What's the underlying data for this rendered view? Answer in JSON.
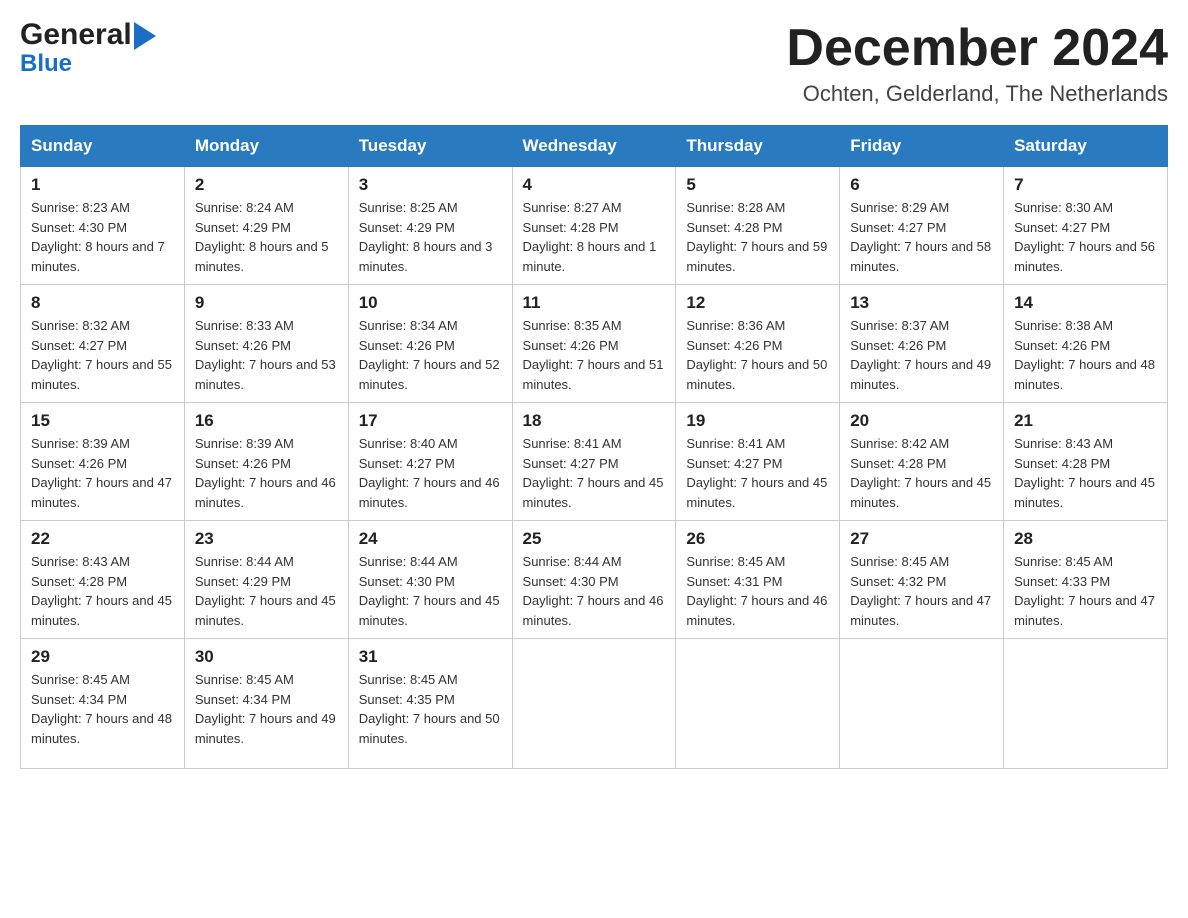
{
  "header": {
    "logo_general": "General",
    "logo_blue": "Blue",
    "month_year": "December 2024",
    "location": "Ochten, Gelderland, The Netherlands"
  },
  "days_of_week": [
    "Sunday",
    "Monday",
    "Tuesday",
    "Wednesday",
    "Thursday",
    "Friday",
    "Saturday"
  ],
  "weeks": [
    [
      {
        "day": "1",
        "sunrise": "8:23 AM",
        "sunset": "4:30 PM",
        "daylight": "8 hours and 7 minutes."
      },
      {
        "day": "2",
        "sunrise": "8:24 AM",
        "sunset": "4:29 PM",
        "daylight": "8 hours and 5 minutes."
      },
      {
        "day": "3",
        "sunrise": "8:25 AM",
        "sunset": "4:29 PM",
        "daylight": "8 hours and 3 minutes."
      },
      {
        "day": "4",
        "sunrise": "8:27 AM",
        "sunset": "4:28 PM",
        "daylight": "8 hours and 1 minute."
      },
      {
        "day": "5",
        "sunrise": "8:28 AM",
        "sunset": "4:28 PM",
        "daylight": "7 hours and 59 minutes."
      },
      {
        "day": "6",
        "sunrise": "8:29 AM",
        "sunset": "4:27 PM",
        "daylight": "7 hours and 58 minutes."
      },
      {
        "day": "7",
        "sunrise": "8:30 AM",
        "sunset": "4:27 PM",
        "daylight": "7 hours and 56 minutes."
      }
    ],
    [
      {
        "day": "8",
        "sunrise": "8:32 AM",
        "sunset": "4:27 PM",
        "daylight": "7 hours and 55 minutes."
      },
      {
        "day": "9",
        "sunrise": "8:33 AM",
        "sunset": "4:26 PM",
        "daylight": "7 hours and 53 minutes."
      },
      {
        "day": "10",
        "sunrise": "8:34 AM",
        "sunset": "4:26 PM",
        "daylight": "7 hours and 52 minutes."
      },
      {
        "day": "11",
        "sunrise": "8:35 AM",
        "sunset": "4:26 PM",
        "daylight": "7 hours and 51 minutes."
      },
      {
        "day": "12",
        "sunrise": "8:36 AM",
        "sunset": "4:26 PM",
        "daylight": "7 hours and 50 minutes."
      },
      {
        "day": "13",
        "sunrise": "8:37 AM",
        "sunset": "4:26 PM",
        "daylight": "7 hours and 49 minutes."
      },
      {
        "day": "14",
        "sunrise": "8:38 AM",
        "sunset": "4:26 PM",
        "daylight": "7 hours and 48 minutes."
      }
    ],
    [
      {
        "day": "15",
        "sunrise": "8:39 AM",
        "sunset": "4:26 PM",
        "daylight": "7 hours and 47 minutes."
      },
      {
        "day": "16",
        "sunrise": "8:39 AM",
        "sunset": "4:26 PM",
        "daylight": "7 hours and 46 minutes."
      },
      {
        "day": "17",
        "sunrise": "8:40 AM",
        "sunset": "4:27 PM",
        "daylight": "7 hours and 46 minutes."
      },
      {
        "day": "18",
        "sunrise": "8:41 AM",
        "sunset": "4:27 PM",
        "daylight": "7 hours and 45 minutes."
      },
      {
        "day": "19",
        "sunrise": "8:41 AM",
        "sunset": "4:27 PM",
        "daylight": "7 hours and 45 minutes."
      },
      {
        "day": "20",
        "sunrise": "8:42 AM",
        "sunset": "4:28 PM",
        "daylight": "7 hours and 45 minutes."
      },
      {
        "day": "21",
        "sunrise": "8:43 AM",
        "sunset": "4:28 PM",
        "daylight": "7 hours and 45 minutes."
      }
    ],
    [
      {
        "day": "22",
        "sunrise": "8:43 AM",
        "sunset": "4:28 PM",
        "daylight": "7 hours and 45 minutes."
      },
      {
        "day": "23",
        "sunrise": "8:44 AM",
        "sunset": "4:29 PM",
        "daylight": "7 hours and 45 minutes."
      },
      {
        "day": "24",
        "sunrise": "8:44 AM",
        "sunset": "4:30 PM",
        "daylight": "7 hours and 45 minutes."
      },
      {
        "day": "25",
        "sunrise": "8:44 AM",
        "sunset": "4:30 PM",
        "daylight": "7 hours and 46 minutes."
      },
      {
        "day": "26",
        "sunrise": "8:45 AM",
        "sunset": "4:31 PM",
        "daylight": "7 hours and 46 minutes."
      },
      {
        "day": "27",
        "sunrise": "8:45 AM",
        "sunset": "4:32 PM",
        "daylight": "7 hours and 47 minutes."
      },
      {
        "day": "28",
        "sunrise": "8:45 AM",
        "sunset": "4:33 PM",
        "daylight": "7 hours and 47 minutes."
      }
    ],
    [
      {
        "day": "29",
        "sunrise": "8:45 AM",
        "sunset": "4:34 PM",
        "daylight": "7 hours and 48 minutes."
      },
      {
        "day": "30",
        "sunrise": "8:45 AM",
        "sunset": "4:34 PM",
        "daylight": "7 hours and 49 minutes."
      },
      {
        "day": "31",
        "sunrise": "8:45 AM",
        "sunset": "4:35 PM",
        "daylight": "7 hours and 50 minutes."
      },
      null,
      null,
      null,
      null
    ]
  ]
}
